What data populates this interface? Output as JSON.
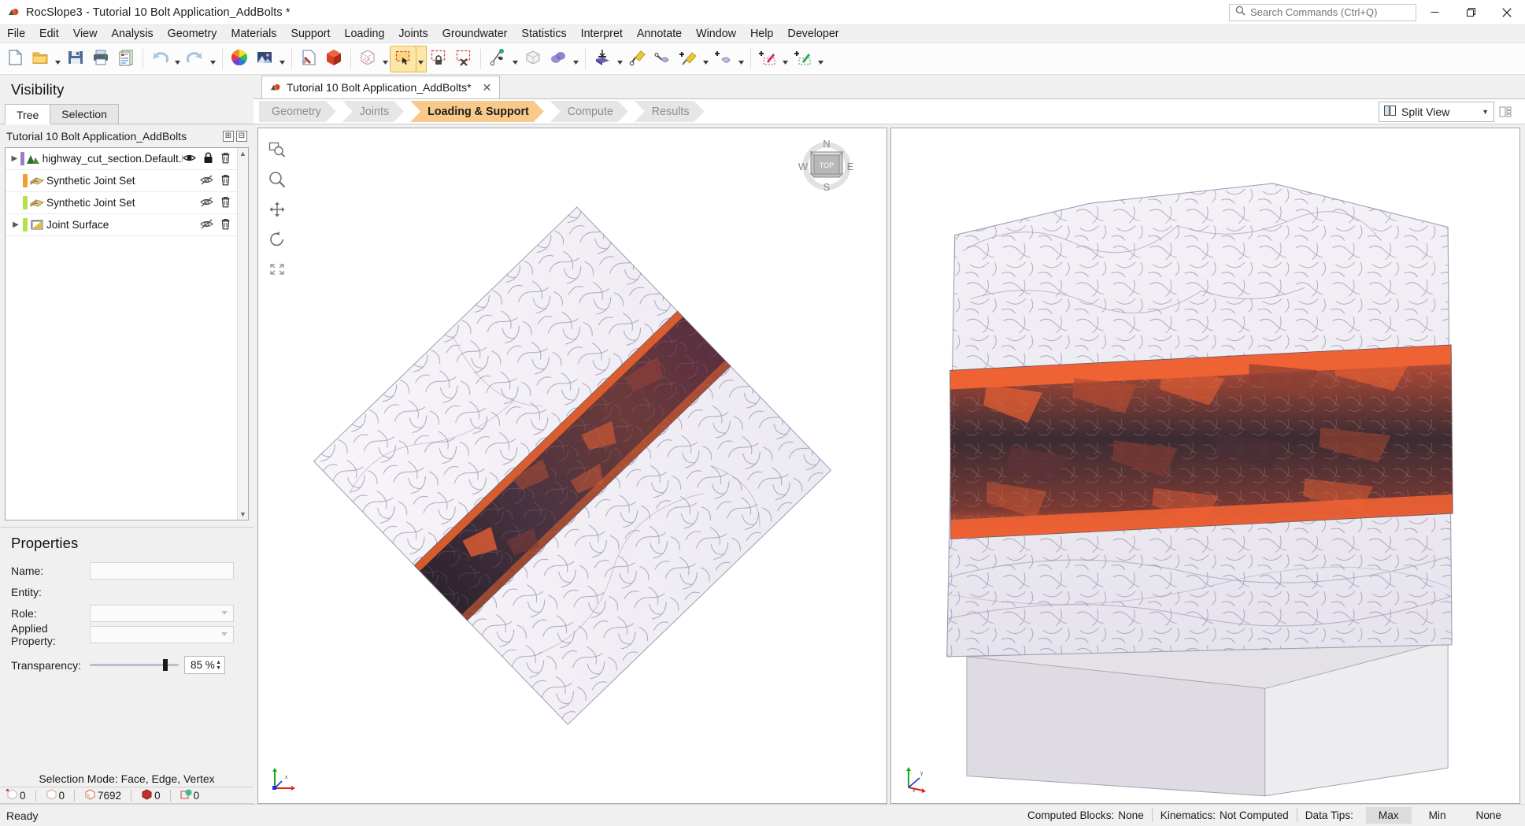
{
  "window": {
    "title": "RocSlope3 - Tutorial 10 Bolt Application_AddBolts *",
    "minimize_label": "—",
    "maximize_label": "❐",
    "close_label": "✕"
  },
  "search": {
    "placeholder": "Search Commands (Ctrl+Q)",
    "value": ""
  },
  "menubar": {
    "items": [
      "File",
      "Edit",
      "View",
      "Analysis",
      "Geometry",
      "Materials",
      "Support",
      "Loading",
      "Joints",
      "Groundwater",
      "Statistics",
      "Interpret",
      "Annotate",
      "Window",
      "Help",
      "Developer"
    ]
  },
  "toolbar": {
    "groups": [
      {
        "buttons": [
          {
            "name": "new-file-icon",
            "dropdown": false
          },
          {
            "name": "open-folder-icon",
            "dropdown": true
          },
          {
            "name": "save-icon",
            "dropdown": false
          },
          {
            "name": "print-icon",
            "dropdown": false
          },
          {
            "name": "report-icon",
            "dropdown": false
          }
        ]
      },
      {
        "buttons": [
          {
            "name": "undo-icon",
            "dropdown": true
          },
          {
            "name": "redo-icon",
            "dropdown": true
          }
        ]
      },
      {
        "buttons": [
          {
            "name": "color-wheel-icon",
            "dropdown": false
          },
          {
            "name": "image-icon",
            "dropdown": true
          }
        ]
      },
      {
        "buttons": [
          {
            "name": "document-tool-icon",
            "dropdown": false
          },
          {
            "name": "solid-block-icon",
            "dropdown": false
          }
        ]
      },
      {
        "buttons": [
          {
            "name": "mesh-box-icon",
            "dropdown": true
          },
          {
            "name": "select-rectangle-icon",
            "dropdown": true,
            "selected": true
          },
          {
            "name": "select-lock-icon",
            "dropdown": false
          },
          {
            "name": "select-clear-icon",
            "dropdown": false
          }
        ]
      },
      {
        "buttons": [
          {
            "name": "pin-tool-icon",
            "dropdown": true
          },
          {
            "name": "wireframe-box-icon",
            "dropdown": false
          },
          {
            "name": "overlap-blocks-icon",
            "dropdown": true
          }
        ]
      },
      {
        "buttons": [
          {
            "name": "import-support-icon",
            "dropdown": true
          },
          {
            "name": "bolt-icon",
            "dropdown": false
          },
          {
            "name": "shotcrete-icon",
            "dropdown": false
          },
          {
            "name": "add-bolt-icon",
            "dropdown": true
          },
          {
            "name": "add-shotcrete-icon",
            "dropdown": true
          }
        ]
      },
      {
        "buttons": [
          {
            "name": "add-red-seismic-icon",
            "dropdown": true
          },
          {
            "name": "add-green-seismic-icon",
            "dropdown": true
          }
        ]
      }
    ]
  },
  "visibility": {
    "panel_title": "Visibility",
    "tabs": [
      {
        "label": "Tree",
        "active": true
      },
      {
        "label": "Selection",
        "active": false
      }
    ],
    "root_label": "Tutorial 10 Bolt Application_AddBolts",
    "root_buttons": [
      {
        "name": "expand-all-button",
        "glyph": "⊞"
      },
      {
        "name": "collapse-all-button",
        "glyph": "⊟"
      }
    ],
    "items": [
      {
        "label": "highway_cut_section.Default.Mesh_",
        "color": "#9b7fc4",
        "icon": "mountain-mesh-icon",
        "expandable": true,
        "visible": true,
        "locked": true,
        "eye_state": "visible"
      },
      {
        "label": "Synthetic Joint Set",
        "color": "#f0a030",
        "icon": "joint-set-icon",
        "expandable": false,
        "visible": false,
        "locked": false,
        "eye_state": "hidden"
      },
      {
        "label": "Synthetic Joint Set",
        "color": "#b5e24a",
        "icon": "joint-set-icon",
        "expandable": false,
        "visible": false,
        "locked": false,
        "eye_state": "hidden"
      },
      {
        "label": "Joint Surface",
        "color": "#b5e24a",
        "icon": "joint-surface-icon",
        "expandable": true,
        "visible": false,
        "locked": false,
        "eye_state": "hidden"
      }
    ]
  },
  "properties": {
    "panel_title": "Properties",
    "fields": [
      {
        "label": "Name:",
        "type": "text",
        "value": ""
      },
      {
        "label": "Entity:",
        "type": "plain",
        "value": ""
      },
      {
        "label": "Role:",
        "type": "combo",
        "value": ""
      },
      {
        "label": "Applied Property:",
        "type": "combo",
        "value": ""
      }
    ],
    "transparency": {
      "label": "Transparency:",
      "value": "85 %",
      "percent": 85
    }
  },
  "selection_status": {
    "mode_text": "Selection Mode: Face, Edge, Vertex",
    "counters": [
      {
        "name": "vertex-count",
        "value": "0"
      },
      {
        "name": "edge-count",
        "value": "0"
      },
      {
        "name": "face-count",
        "value": "7692"
      },
      {
        "name": "block-count",
        "value": "0"
      },
      {
        "name": "other-count",
        "value": "0"
      }
    ]
  },
  "document_tab": {
    "label": "Tutorial 10 Bolt Application_AddBolts*",
    "close_glyph": "✕"
  },
  "workflow": {
    "steps": [
      {
        "label": "Geometry",
        "active": false
      },
      {
        "label": "Joints",
        "active": false
      },
      {
        "label": "Loading & Support",
        "active": true
      },
      {
        "label": "Compute",
        "active": false
      },
      {
        "label": "Results",
        "active": false
      }
    ]
  },
  "view_controls": {
    "split_view_label": "Split View",
    "split_view_caret": "▼",
    "layout_button": "view-layout-icon"
  },
  "nav_tools": [
    {
      "name": "zoom-window-icon"
    },
    {
      "name": "zoom-icon"
    },
    {
      "name": "pan-icon"
    },
    {
      "name": "rotate-icon"
    },
    {
      "name": "zoom-all-icon"
    }
  ],
  "compass": {
    "north": "N",
    "south": "S",
    "east": "E",
    "west": "W",
    "face": "TOP"
  },
  "axes": {
    "x": "x",
    "y": "y",
    "z": "z"
  },
  "statusbar": {
    "ready": "Ready",
    "computed_blocks_label": "Computed Blocks:",
    "computed_blocks_value": "None",
    "kinematics_label": "Kinematics:",
    "kinematics_value": "Not Computed",
    "data_tips_label": "Data Tips:",
    "data_tips_options": [
      {
        "label": "Max",
        "active": true
      },
      {
        "label": "Min",
        "active": false
      },
      {
        "label": "None",
        "active": false
      }
    ]
  },
  "colors": {
    "accent_orange": "#f9c98b",
    "selection_orange": "#fde7a8",
    "mesh_purple": "#9b7fc4",
    "joint_orange": "#f0a030",
    "joint_green": "#b5e24a",
    "model_rock": "#ef6233",
    "model_dark": "#3a2f3a",
    "model_light": "#f2f0f5"
  }
}
